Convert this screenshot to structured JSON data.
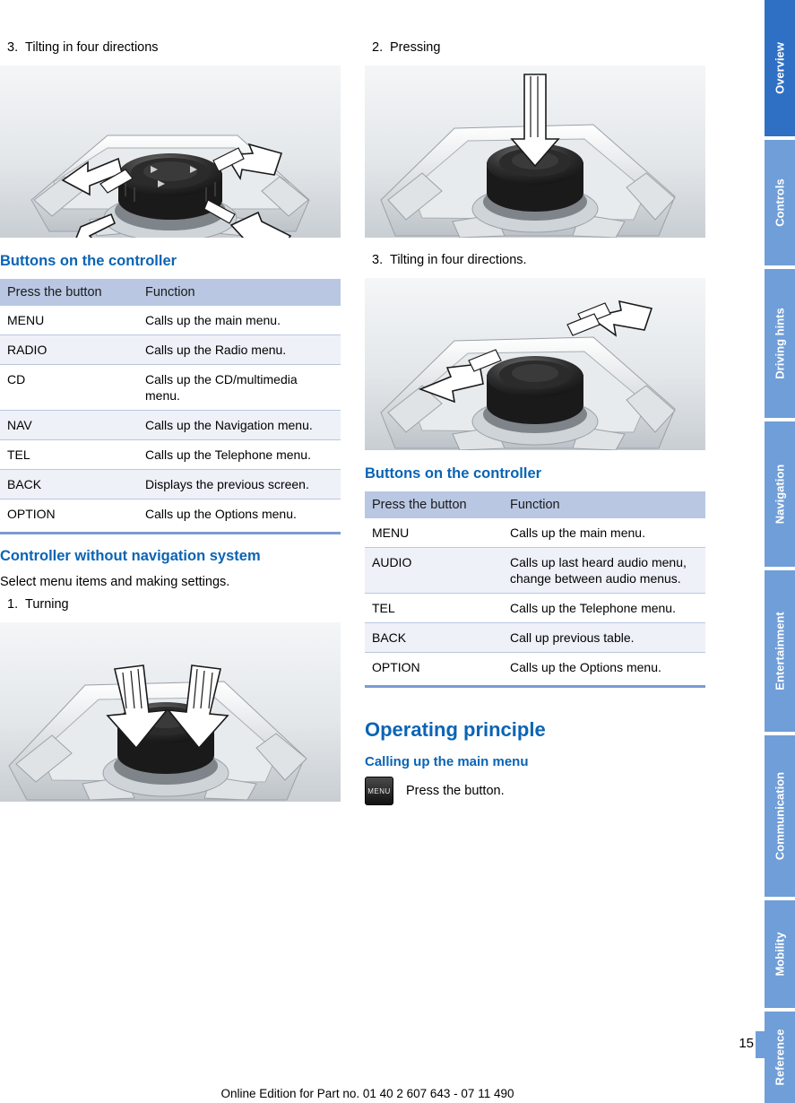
{
  "document": {
    "page_number": "15",
    "footer": "Online Edition for Part no. 01 40 2 607 643 - 07 11 490"
  },
  "left_column": {
    "step3": {
      "num": "3.",
      "text": "Tilting in four directions"
    },
    "figure1_name": "controller-tilt-four-directions-illustration",
    "heading_buttons": "Buttons on the controller",
    "table1": {
      "headers": [
        "Press the button",
        "Function"
      ],
      "rows": [
        [
          "MENU",
          "Calls up the main menu."
        ],
        [
          "RADIO",
          "Calls up the Radio menu."
        ],
        [
          "CD",
          "Calls up the CD/multimedia menu."
        ],
        [
          "NAV",
          "Calls up the Navigation menu."
        ],
        [
          "TEL",
          "Calls up the Telephone menu."
        ],
        [
          "BACK",
          "Displays the previous screen."
        ],
        [
          "OPTION",
          "Calls up the Options menu."
        ]
      ]
    },
    "heading_controller_without_nav": "Controller without navigation system",
    "intro_text": "Select menu items and making settings.",
    "step1": {
      "num": "1.",
      "text": "Turning"
    },
    "figure2_name": "controller-turning-illustration"
  },
  "right_column": {
    "step2": {
      "num": "2.",
      "text": "Pressing"
    },
    "figure3_name": "controller-pressing-illustration",
    "step3": {
      "num": "3.",
      "text": "Tilting in four directions."
    },
    "figure4_name": "controller-tilt-four-directions-illustration-2",
    "heading_buttons": "Buttons on the controller",
    "table2": {
      "headers": [
        "Press the button",
        "Function"
      ],
      "rows": [
        [
          "MENU",
          "Calls up the main menu."
        ],
        [
          "AUDIO",
          "Calls up last heard audio menu, change between audio menus."
        ],
        [
          "TEL",
          "Calls up the Telephone menu."
        ],
        [
          "BACK",
          "Call up previous table."
        ],
        [
          "OPTION",
          "Calls up the Options menu."
        ]
      ]
    },
    "heading_operating_principle": "Operating principle",
    "heading_calling_main_menu": "Calling up the main menu",
    "menu_key_label": "MENU",
    "menu_instruction": "Press the button."
  },
  "side_tabs": [
    {
      "label": "Overview",
      "style": "dk"
    },
    {
      "label": "Controls",
      "style": "lt"
    },
    {
      "label": "Driving hints",
      "style": "lt"
    },
    {
      "label": "Navigation",
      "style": "lt"
    },
    {
      "label": "Entertainment",
      "style": "lt"
    },
    {
      "label": "Communication",
      "style": "lt"
    },
    {
      "label": "Mobility",
      "style": "lt"
    },
    {
      "label": "Reference",
      "style": "lt"
    }
  ],
  "colors": {
    "accent_blue": "#0a64b4",
    "tab_blue": "#2f6fc4",
    "tab_light": "#6f9ed8",
    "table_header": "#b9c7e2"
  }
}
